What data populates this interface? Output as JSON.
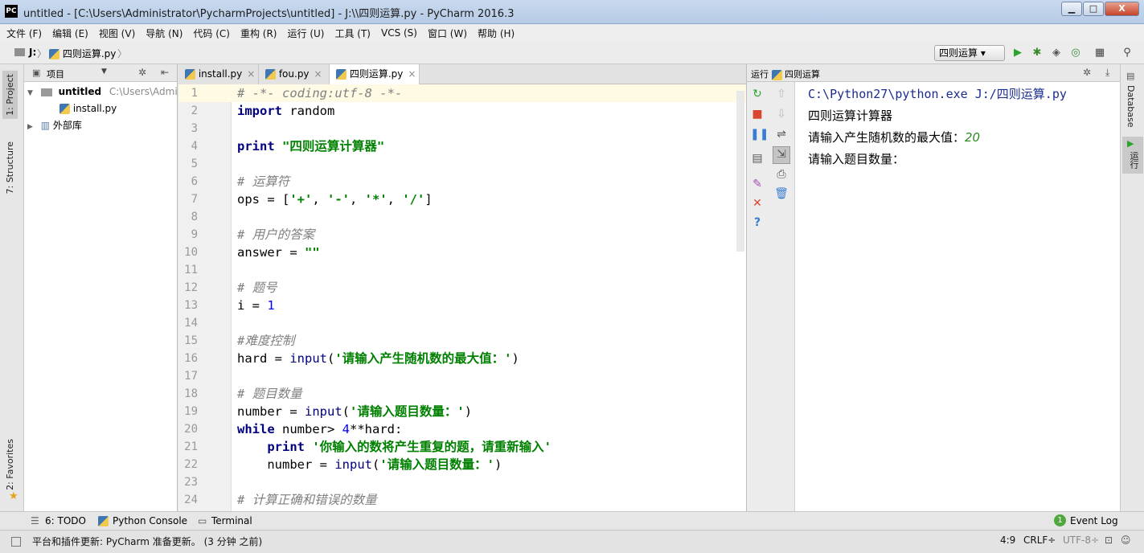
{
  "window": {
    "title": "untitled - [C:\\Users\\Administrator\\PycharmProjects\\untitled] - J:\\\\四则运算.py - PyCharm 2016.3",
    "app_icon": "PC",
    "minimize": "▁",
    "maximize": "□",
    "close": "X"
  },
  "menu": [
    "文件 (F)",
    "编辑 (E)",
    "视图 (V)",
    "导航 (N)",
    "代码 (C)",
    "重构 (R)",
    "运行 (U)",
    "工具 (T)",
    "VCS (S)",
    "窗口 (W)",
    "帮助 (H)"
  ],
  "navbar": {
    "drive": "J:",
    "file": "四则运算.py",
    "sep": "〉",
    "run_config": "四则运算 ▾",
    "icons": [
      "run-icon",
      "debug-icon",
      "coverage-icon",
      "profile-icon",
      "stop-icon",
      "search-icon"
    ]
  },
  "left_tabs": {
    "project": "1: Project",
    "structure": "7: Structure",
    "favorites": "2: Favorites"
  },
  "project": {
    "header": "项目",
    "root_name": "untitled",
    "root_path": "C:\\Users\\Admini",
    "file": "install.py",
    "external": "外部库"
  },
  "tabs": [
    {
      "label": "install.py",
      "close": "×"
    },
    {
      "label": "fou.py",
      "close": "×"
    },
    {
      "label": "四则运算.py",
      "close": "×"
    }
  ],
  "code_lines": [
    "1",
    "2",
    "3",
    "4",
    "5",
    "6",
    "7",
    "8",
    "9",
    "10",
    "11",
    "12",
    "13",
    "14",
    "15",
    "16",
    "17",
    "18",
    "19",
    "20",
    "21",
    "22",
    "23",
    "24"
  ],
  "code": {
    "l1": "# -*- coding:utf-8 -*-",
    "l2_kw": "import",
    "l2_rest": " random",
    "l4_kw": "print",
    "l4_str": " \"四则运算计算器\"",
    "l6": "# 运算符",
    "l7_a": "ops = [",
    "l7_s1": "'+'",
    "l7_c1": ", ",
    "l7_s2": "'-'",
    "l7_c2": ", ",
    "l7_s3": "'*'",
    "l7_c3": ", ",
    "l7_s4": "'/'",
    "l7_e": "]",
    "l9": "# 用户的答案",
    "l10_a": "answer = ",
    "l10_s": "\"\"",
    "l12": "# 题号",
    "l13_a": "i = ",
    "l13_n": "1",
    "l15": "#难度控制",
    "l16_a": "hard = ",
    "l16_f": "input",
    "l16_p": "(",
    "l16_s": "'请输入产生随机数的最大值：'",
    "l16_e": ")",
    "l18": "# 题目数量",
    "l19_a": "number = ",
    "l19_f": "input",
    "l19_p": "(",
    "l19_s": "'请输入题目数量：'",
    "l19_e": ")",
    "l20_kw": "while",
    "l20_a": " number> ",
    "l20_n": "4",
    "l20_e": "**hard:",
    "l21_i": "    ",
    "l21_kw": "print",
    "l21_s": " '你输入的数将产生重复的题，请重新输入'",
    "l22_a": "    number = ",
    "l22_f": "input",
    "l22_p": "(",
    "l22_s": "'请输入题目数量：'",
    "l22_e": ")",
    "l24": "# 计算正确和错误的数量"
  },
  "run": {
    "header_prefix": "运行",
    "header_name": "四则运算",
    "cmd": "C:\\Python27\\python.exe J:/四则运算.py",
    "out1": "四则运算计算器",
    "out2_prompt": "请输入产生随机数的最大值：",
    "out2_input": "20",
    "out3": "请输入题目数量："
  },
  "right_tabs": {
    "database": "Database",
    "run": "运行"
  },
  "bottom_tools": {
    "todo": "6: TODO",
    "console": "Python Console",
    "terminal": "Terminal",
    "event_log": "Event Log",
    "event_count": "1"
  },
  "status": {
    "message": "平台和插件更新: PyCharm 准备更新。 (3 分钟 之前)",
    "position": "4:9",
    "line_sep": "CRLF÷",
    "encoding": "UTF-8÷"
  }
}
